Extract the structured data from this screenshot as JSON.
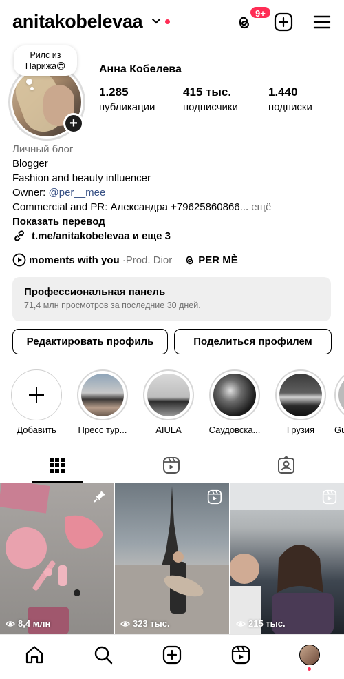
{
  "header": {
    "username": "anitakobelevaa",
    "notifications_badge": "9+",
    "icons": [
      "threads-icon",
      "add-post-icon",
      "menu-icon"
    ]
  },
  "note": {
    "text": "Рилс из Парижа😍"
  },
  "profile": {
    "full_name": "Анна Кобелева",
    "stats": [
      {
        "value": "1.285",
        "label": "публикации"
      },
      {
        "value": "415 тыс.",
        "label": "подписчики"
      },
      {
        "value": "1.440",
        "label": "подписки"
      }
    ]
  },
  "bio": {
    "category": "Личный блог",
    "line1": "Blogger",
    "line2": "Fashion and beauty influencer",
    "owner_prefix": "Owner: ",
    "owner_link": "@per__mee",
    "commercial": "Commercial and PR: Александра +79625860866...",
    "more": " ещё",
    "translate": "Показать перевод",
    "link": "t.me/anitakobelevaa и еще 3"
  },
  "music": {
    "song": "moments with you",
    "separator": " · ",
    "artist": "Prod. Dior",
    "threads_name": "PER MÈ"
  },
  "dashboard": {
    "title": "Профессиональная панель",
    "subtitle": "71,4 млн просмотров за последние 30 дней."
  },
  "buttons": {
    "edit": "Редактировать профиль",
    "share": "Поделиться профилем"
  },
  "highlights": [
    {
      "label": "Добавить"
    },
    {
      "label": "Пресс тур..."
    },
    {
      "label": "AIULA"
    },
    {
      "label": "Саудовска..."
    },
    {
      "label": "Грузия"
    },
    {
      "label": "Gu"
    }
  ],
  "grid": [
    {
      "views": "8,4 млн",
      "icon": "pin-icon"
    },
    {
      "views": "323 тыс.",
      "icon": "reels-icon"
    },
    {
      "views": "215 тыс.",
      "icon": "reels-icon"
    }
  ],
  "colors": {
    "badge": "#ff2d55",
    "link": "#385185",
    "muted": "#737373",
    "panel": "#efefef"
  }
}
